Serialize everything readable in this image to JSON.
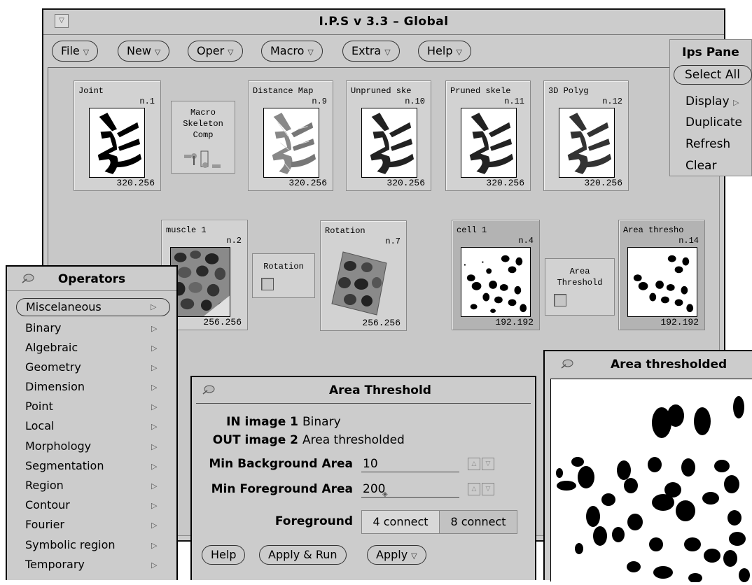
{
  "main_window": {
    "title": "I.P.S v 3.3 – Global",
    "menus": [
      {
        "label": "File"
      },
      {
        "label": "New"
      },
      {
        "label": "Oper"
      },
      {
        "label": "Macro"
      },
      {
        "label": "Extra"
      },
      {
        "label": "Help"
      }
    ]
  },
  "tiles": [
    {
      "name": "Joint",
      "num": "n.1",
      "size": "320.256"
    },
    {
      "name": "Distance Map",
      "num": "n.9",
      "size": "320.256"
    },
    {
      "name": "Unpruned ske",
      "num": "n.10",
      "size": "320.256"
    },
    {
      "name": "Pruned skele",
      "num": "n.11",
      "size": "320.256"
    },
    {
      "name": "3D Polyg",
      "num": "n.12",
      "size": "320.256"
    },
    {
      "name": "muscle 1",
      "num": "n.2",
      "size": "256.256"
    },
    {
      "name": "Rotation",
      "num": "n.7",
      "size": "256.256"
    },
    {
      "name": "cell 1",
      "num": "n.4",
      "size": "192.192"
    },
    {
      "name": "Area thresho",
      "num": "n.14",
      "size": "192.192"
    }
  ],
  "operators_boxes": {
    "macro": [
      "Macro",
      "Skeleton",
      "Comp"
    ],
    "rotation": "Rotation",
    "area": [
      "Area",
      "Threshold"
    ]
  },
  "ips_pane": {
    "title": "Ips Pane",
    "items": [
      "Select All",
      "Display",
      "Duplicate",
      "Refresh",
      "Clear"
    ]
  },
  "operators_window": {
    "title": "Operators",
    "items": [
      "Miscelaneous",
      "Binary",
      "Algebraic",
      "Geometry",
      "Dimension",
      "Point",
      "Local",
      "Morphology",
      "Segmentation",
      "Region",
      "Contour",
      "Fourier",
      "Symbolic region",
      "Temporary"
    ]
  },
  "area_threshold_dialog": {
    "title": "Area Threshold",
    "in_label": "IN image 1",
    "in_value": "Binary",
    "out_label": "OUT image 2",
    "out_value": "Area thresholded",
    "min_bg_label": "Min Background Area",
    "min_bg_value": "10",
    "min_fg_label": "Min Foreground Area",
    "min_fg_value": "200",
    "fg_label": "Foreground",
    "fg_options": [
      "4 connect",
      "8 connect"
    ],
    "buttons": {
      "help": "Help",
      "apply_run": "Apply & Run",
      "apply": "Apply"
    }
  },
  "area_thresholded_window": {
    "title": "Area thresholded"
  },
  "colors": {
    "panel": "#cccccc",
    "dark_tile": "#b3b3b3",
    "border": "#000000"
  }
}
